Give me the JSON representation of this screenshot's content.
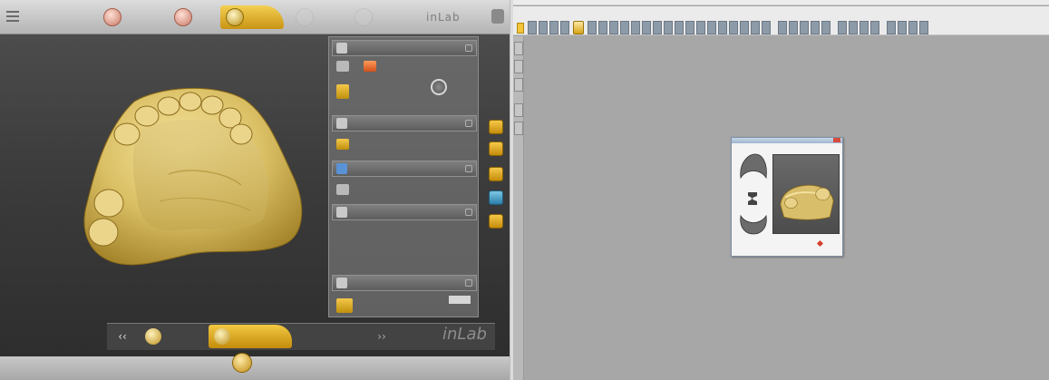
{
  "inlab": {
    "case_info": "",
    "phases": [
      {
        "name": "phase-administration",
        "label": ""
      },
      {
        "name": "phase-scan",
        "label": ""
      },
      {
        "name": "phase-model",
        "label": ""
      },
      {
        "name": "phase-design",
        "label": ""
      },
      {
        "name": "phase-manufacture",
        "label": ""
      }
    ],
    "brand": "inLab",
    "panel_sections": [
      {
        "title": ""
      },
      {
        "title": ""
      },
      {
        "title": ""
      },
      {
        "title": ""
      },
      {
        "title": ""
      }
    ],
    "rows": [
      {
        "label": ""
      },
      {
        "label": ""
      },
      {
        "label": ""
      },
      {
        "label": ""
      },
      {
        "label": ""
      },
      {
        "label": ""
      }
    ],
    "option_list": [
      "",
      "",
      "",
      "",
      ""
    ],
    "value_readout": "",
    "steps": [
      {
        "label": ""
      },
      {
        "label": ""
      }
    ],
    "mark": "inLab",
    "mark_sub": "",
    "accent_color": "#d9a520"
  },
  "legacy": {
    "title": "",
    "dialog_caption": ""
  }
}
